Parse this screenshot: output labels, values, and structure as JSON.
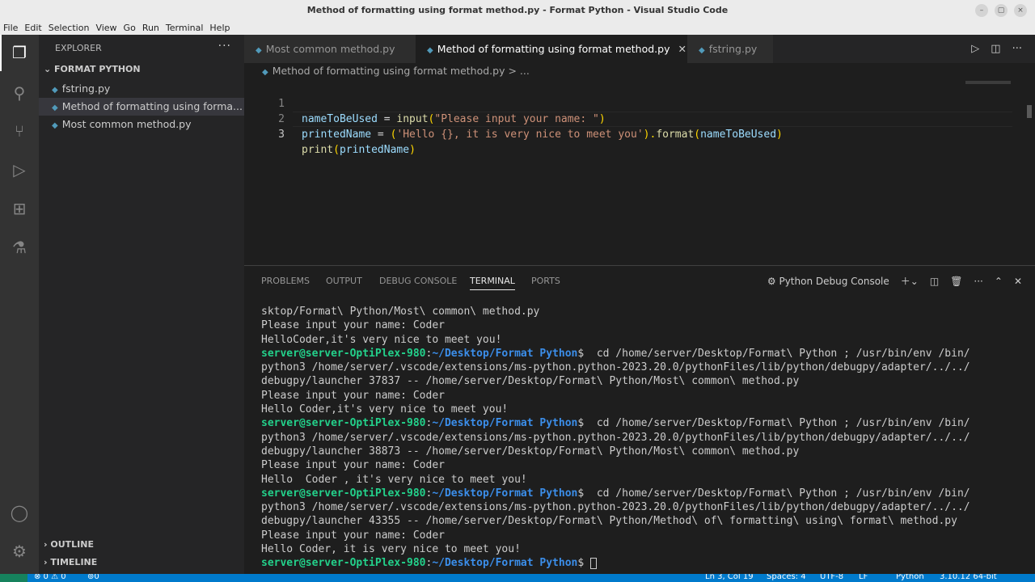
{
  "window": {
    "title": "Method of formatting using format method.py - Format Python - Visual Studio Code",
    "btn_min": "–",
    "btn_max": "▢",
    "btn_close": "×"
  },
  "menu": [
    "File",
    "Edit",
    "Selection",
    "View",
    "Go",
    "Run",
    "Terminal",
    "Help"
  ],
  "sidebar": {
    "header": "EXPLORER",
    "more": "···",
    "folder": "FORMAT PYTHON",
    "files": [
      "fstring.py",
      "Method of formatting using forma...",
      "Most common method.py"
    ],
    "outline": "OUTLINE",
    "timeline": "TIMELINE"
  },
  "tabs": [
    "Most common method.py",
    "Method of formatting using format method.py",
    "fstring.py"
  ],
  "breadcrumb": "Method of formatting using format method.py > ...",
  "code": {
    "l1": {
      "n": "1",
      "var": "nameToBeUsed",
      "eq": " = ",
      "fn": "input",
      "op": "(",
      "str": "\"Please input your name: \"",
      "cp": ")"
    },
    "l2": {
      "n": "2",
      "var": "printedName",
      "eq": " = ",
      "op": "(",
      "str": "'Hello {}, it is very nice to meet you'",
      "cp": ").",
      "fn": "format",
      "op2": "(",
      "arg": "nameToBeUsed",
      "cp2": ")"
    },
    "l3": {
      "n": "3",
      "fn": "print",
      "op": "(",
      "arg": "printedName",
      "cp": ")"
    }
  },
  "panel": {
    "tabs": [
      "PROBLEMS",
      "OUTPUT",
      "DEBUG CONSOLE",
      "TERMINAL",
      "PORTS"
    ],
    "console_label": "Python Debug Console"
  },
  "terminal": {
    "prompt_user": "server@server-OptiPlex-980",
    "prompt_path": "~/Desktop/Format Python",
    "lines": [
      "sktop/Format\\ Python/Most\\ common\\ method.py",
      "Please input your name: Coder",
      "HelloCoder,it's very nice to meet you!",
      "",
      "python3 /home/server/.vscode/extensions/ms-python.python-2023.20.0/pythonFiles/lib/python/debugpy/adapter/../../",
      "debugpy/launcher 37837 -- /home/server/Desktop/Format\\ Python/Most\\ common\\ method.py",
      "Please input your name: Coder",
      "Hello Coder,it's very nice to meet you!",
      "",
      "python3 /home/server/.vscode/extensions/ms-python.python-2023.20.0/pythonFiles/lib/python/debugpy/adapter/../../",
      "debugpy/launcher 38873 -- /home/server/Desktop/Format\\ Python/Most\\ common\\ method.py",
      "Please input your name: Coder",
      "Hello  Coder , it's very nice to meet you!",
      "",
      "python3 /home/server/.vscode/extensions/ms-python.python-2023.20.0/pythonFiles/lib/python/debugpy/adapter/../../",
      "debugpy/launcher 43355 -- /home/server/Desktop/Format\\ Python/Method\\ of\\ formatting\\ using\\ format\\ method.py",
      "Please input your name: Coder",
      "Hello Coder, it is very nice to meet you!"
    ],
    "cmd": "$  cd /home/server/Desktop/Format\\ Python ; /usr/bin/env /bin/",
    "last": "$ "
  },
  "status": {
    "errors": "⊗ 0 ⚠ 0",
    "ports": "⊚0",
    "pos": "Ln 3, Col 19",
    "spaces": "Spaces: 4",
    "enc": "UTF-8",
    "eol": "LF",
    "lang": "Python",
    "ver": "3.10.12 64-bit"
  }
}
